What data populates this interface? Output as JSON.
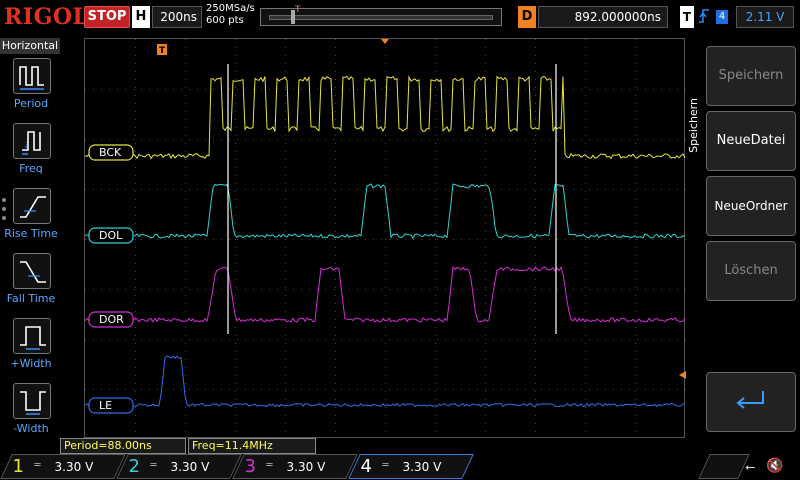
{
  "header": {
    "logo": "RIGOL",
    "run_state": "STOP",
    "horiz_label": "H",
    "timebase": "200ns",
    "sample_rate": "250MSa/s",
    "points": "600 pts",
    "trigger_marker": "T",
    "delay_label": "D",
    "delay_value": "892.000000ns",
    "trigger_label": "T",
    "trigger_source": "4",
    "trigger_level": "2.11 V"
  },
  "left_panel": {
    "title": "Horizontal",
    "items": [
      {
        "label": "Period",
        "icon": "period-icon"
      },
      {
        "label": "Freq",
        "icon": "freq-icon"
      },
      {
        "label": "Rise Time",
        "icon": "rise-time-icon"
      },
      {
        "label": "Fall Time",
        "icon": "fall-time-icon"
      },
      {
        "label": "+Width",
        "icon": "pos-width-icon"
      },
      {
        "label": "-Width",
        "icon": "neg-width-icon"
      }
    ]
  },
  "right_panel": {
    "tab_label": "Speichern",
    "buttons": [
      {
        "label": "Speichern",
        "enabled": false
      },
      {
        "label": "NeueDatei",
        "enabled": true
      },
      {
        "label": "NeueOrdner",
        "enabled": true
      },
      {
        "label": "Löschen",
        "enabled": false
      },
      {
        "label": "",
        "icon": "return-icon",
        "enabled": true
      }
    ]
  },
  "traces": [
    {
      "channel": "1",
      "label": "BCK",
      "color": "#e6e63c"
    },
    {
      "channel": "2",
      "label": "DOL",
      "color": "#2ed4d4"
    },
    {
      "channel": "3",
      "label": "DOR",
      "color": "#d42ed4"
    },
    {
      "channel": "4",
      "label": "LE",
      "color": "#2f6fe8"
    }
  ],
  "measurements": {
    "period": "Period=88.00ns",
    "freq": "Freq=11.4MHz"
  },
  "channels": [
    {
      "num": "1",
      "coupling": "═",
      "volts": "3.30 V",
      "color": "#e6e63c"
    },
    {
      "num": "2",
      "coupling": "═",
      "volts": "3.30 V",
      "color": "#2ed4d4"
    },
    {
      "num": "3",
      "coupling": "═",
      "volts": "3.30 V",
      "color": "#d42ed4"
    },
    {
      "num": "4",
      "coupling": "═",
      "volts": "3.30 V",
      "color": "#2f6fe8"
    }
  ]
}
